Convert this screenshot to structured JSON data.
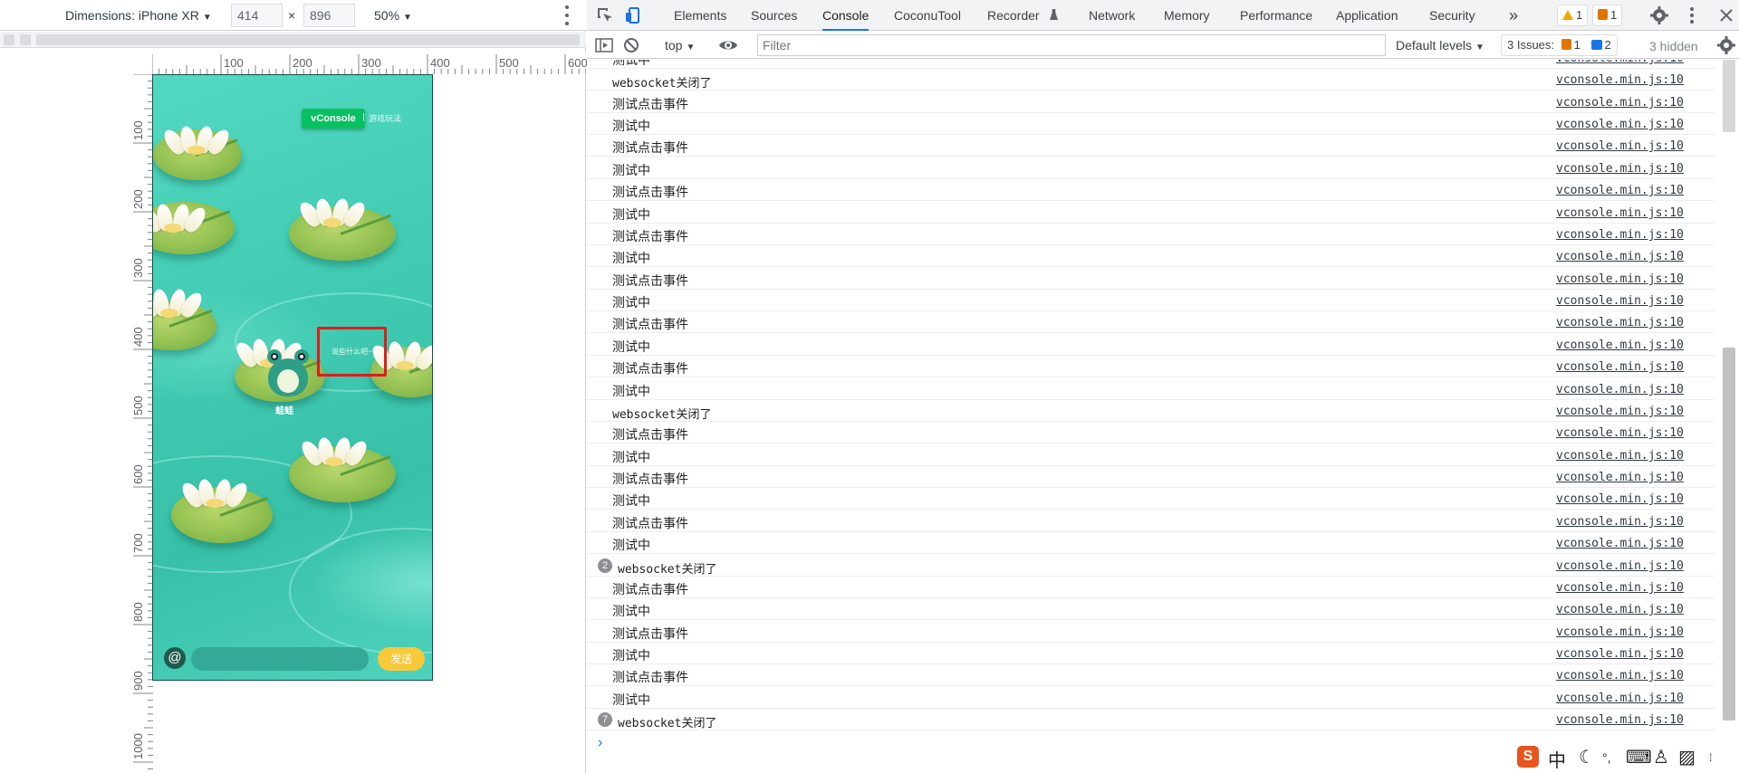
{
  "device_toolbar": {
    "dimensions_label": "Dimensions: iPhone XR",
    "width": "414",
    "times": "×",
    "height": "896",
    "zoom": "50%"
  },
  "rulers": {
    "horizontal": [
      "100",
      "200",
      "300",
      "400",
      "500",
      "600"
    ],
    "vertical": [
      "100",
      "200",
      "300",
      "400",
      "500",
      "600",
      "700",
      "800",
      "900",
      "1000"
    ]
  },
  "game": {
    "vconsole_button": "vConsole",
    "rules_link": "游戏玩法",
    "speech": "说些什么吧~",
    "frog_name": "蛙蛙",
    "at_symbol": "@",
    "chat_placeholder": "",
    "send_button": "发送"
  },
  "devtools": {
    "tabs": [
      "Elements",
      "Sources",
      "Console",
      "CoconuTool",
      "Recorder",
      "Network",
      "Memory",
      "Performance",
      "Application",
      "Security"
    ],
    "active_tab": "Console",
    "more_tabs": "»",
    "warning_count": "1",
    "issue_count": "1",
    "context": "top",
    "filter_placeholder": "Filter",
    "levels": "Default levels",
    "issues_label": "3 Issues:",
    "issues_warn": "1",
    "issues_info": "2",
    "hidden": "3 hidden"
  },
  "console": {
    "source": "vconsole.min.js:10",
    "rows": [
      {
        "text": "测试中",
        "count": ""
      },
      {
        "text": "websocket关闭了",
        "count": ""
      },
      {
        "text": "测试点击事件",
        "count": ""
      },
      {
        "text": "测试中",
        "count": ""
      },
      {
        "text": "测试点击事件",
        "count": ""
      },
      {
        "text": "测试中",
        "count": ""
      },
      {
        "text": "测试点击事件",
        "count": ""
      },
      {
        "text": "测试中",
        "count": ""
      },
      {
        "text": "测试点击事件",
        "count": ""
      },
      {
        "text": "测试中",
        "count": ""
      },
      {
        "text": "测试点击事件",
        "count": ""
      },
      {
        "text": "测试中",
        "count": ""
      },
      {
        "text": "测试点击事件",
        "count": ""
      },
      {
        "text": "测试中",
        "count": ""
      },
      {
        "text": "测试点击事件",
        "count": ""
      },
      {
        "text": "测试中",
        "count": ""
      },
      {
        "text": "websocket关闭了",
        "count": ""
      },
      {
        "text": "测试点击事件",
        "count": ""
      },
      {
        "text": "测试中",
        "count": ""
      },
      {
        "text": "测试点击事件",
        "count": ""
      },
      {
        "text": "测试中",
        "count": ""
      },
      {
        "text": "测试点击事件",
        "count": ""
      },
      {
        "text": "测试中",
        "count": ""
      },
      {
        "text": "websocket关闭了",
        "count": "2"
      },
      {
        "text": "测试点击事件",
        "count": ""
      },
      {
        "text": "测试中",
        "count": ""
      },
      {
        "text": "测试点击事件",
        "count": ""
      },
      {
        "text": "测试中",
        "count": ""
      },
      {
        "text": "测试点击事件",
        "count": ""
      },
      {
        "text": "测试中",
        "count": ""
      },
      {
        "text": "websocket关闭了",
        "count": "7"
      }
    ],
    "prompt": "›"
  },
  "ime": {
    "logo": "S",
    "mode": "中"
  },
  "colors": {
    "accent": "#1a73e8",
    "vconsole_green": "#07c160",
    "highlight_red": "#e21b1b",
    "send_yellow": "#f7c93b",
    "water": "#3fc9b0"
  }
}
